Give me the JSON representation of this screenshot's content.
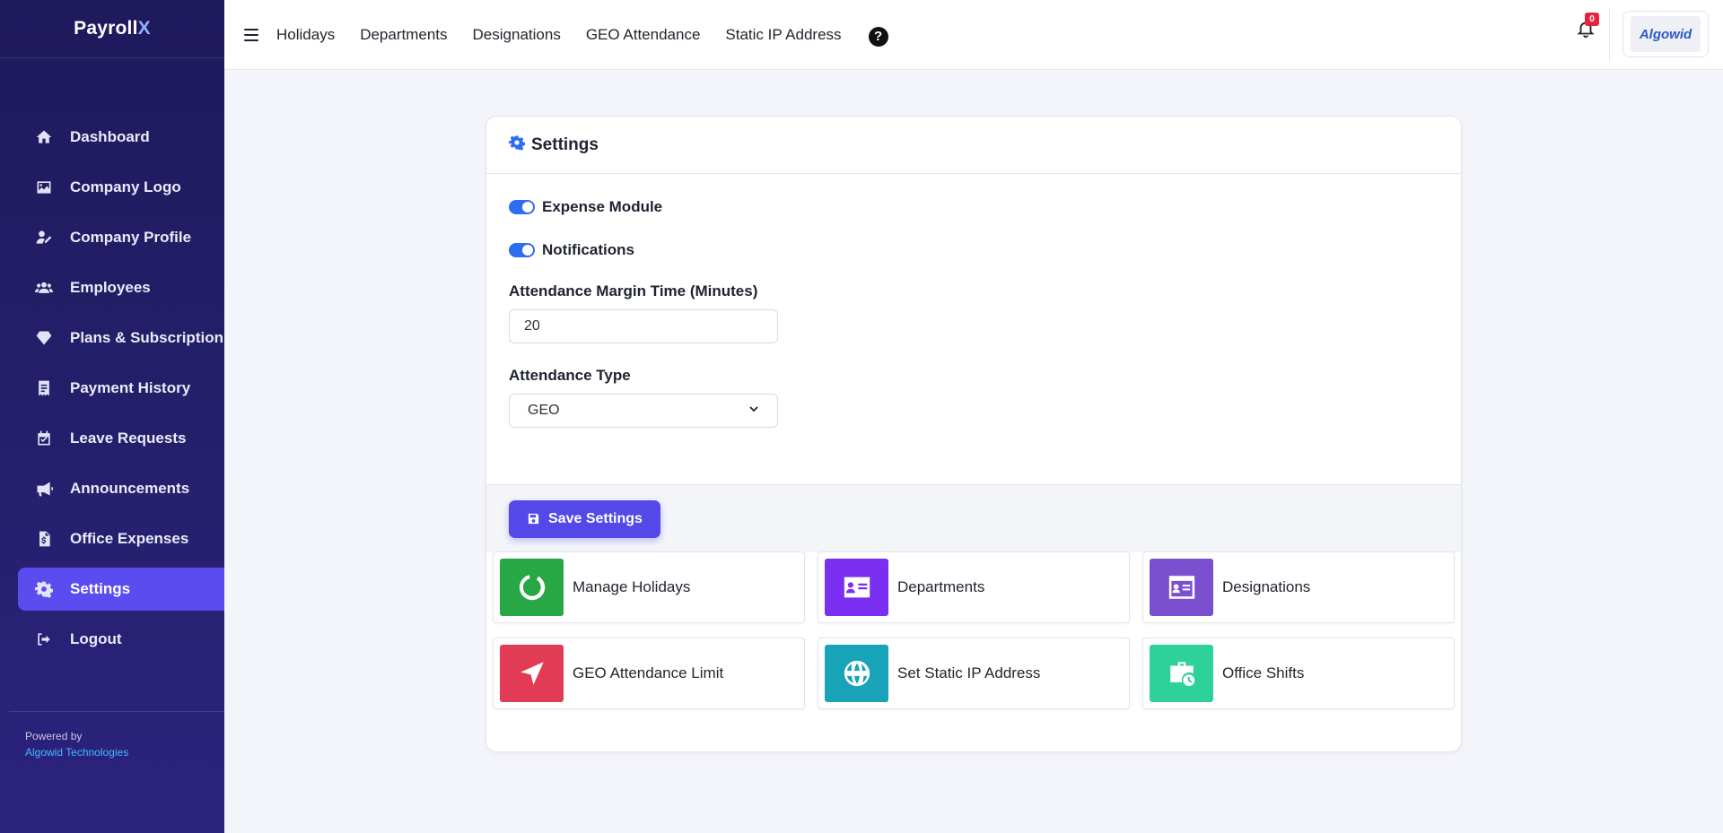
{
  "brand": {
    "name": "Payroll",
    "accent": "X"
  },
  "sidebar": {
    "items": [
      {
        "label": "Dashboard",
        "icon": "home-icon"
      },
      {
        "label": "Company Logo",
        "icon": "image-icon"
      },
      {
        "label": "Company Profile",
        "icon": "user-edit-icon"
      },
      {
        "label": "Employees",
        "icon": "users-icon"
      },
      {
        "label": "Plans & Subscription",
        "icon": "gem-icon"
      },
      {
        "label": "Payment History",
        "icon": "receipt-icon"
      },
      {
        "label": "Leave Requests",
        "icon": "calendar-check-icon"
      },
      {
        "label": "Announcements",
        "icon": "megaphone-icon"
      },
      {
        "label": "Office Expenses",
        "icon": "invoice-icon"
      },
      {
        "label": "Settings",
        "icon": "gear-icon",
        "active": true
      },
      {
        "label": "Logout",
        "icon": "logout-icon"
      }
    ],
    "powered_by": "Powered by",
    "company": "Algowid Technologies"
  },
  "topbar": {
    "links": [
      "Holidays",
      "Departments",
      "Designations",
      "GEO Attendance",
      "Static IP Address"
    ],
    "help": "?",
    "notification_count": "0",
    "logo_text": "Algowid"
  },
  "settings": {
    "title": "Settings",
    "expense_module_label": "Expense Module",
    "expense_module_enabled": true,
    "notifications_label": "Notifications",
    "notifications_enabled": true,
    "margin_time_label": "Attendance Margin Time (Minutes)",
    "margin_time_value": "20",
    "attendance_type_label": "Attendance Type",
    "attendance_type_value": "GEO",
    "save_label": "Save Settings"
  },
  "tiles": [
    {
      "label": "Manage Holidays",
      "color": "#28a745",
      "icon": "circle-notch-icon"
    },
    {
      "label": "Departments",
      "color": "#7b2ff0",
      "icon": "id-card-icon"
    },
    {
      "label": "Designations",
      "color": "#7a4fd0",
      "icon": "id-card-icon"
    },
    {
      "label": "GEO Attendance Limit",
      "color": "#e23b55",
      "icon": "location-arrow-icon"
    },
    {
      "label": "Set Static IP Address",
      "color": "#18a3b8",
      "icon": "globe-icon"
    },
    {
      "label": "Office Shifts",
      "color": "#2fd19a",
      "icon": "briefcase-clock-icon"
    }
  ],
  "colors": {
    "accent": "#5448e8",
    "sidebar": "#241f6a",
    "toggle": "#2e6df0"
  }
}
